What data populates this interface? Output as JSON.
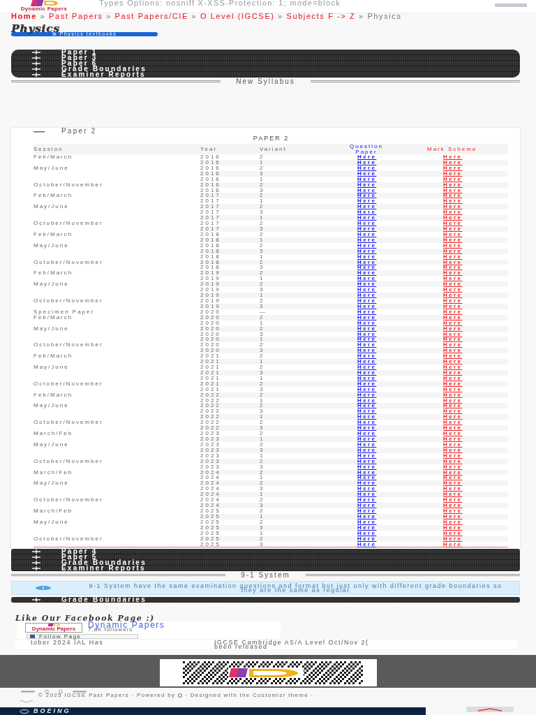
{
  "header": {
    "logo_text": "Dynamic Papers",
    "text": "Types Options: nosniff X-XSS-Protection: 1; mode=block"
  },
  "breadcrumb": {
    "separator": "»",
    "links": [
      "Home",
      "Past Papers",
      "Past Papers/CIE",
      "O Level (IGCSE)",
      "Subjects F -> Z"
    ],
    "current": "Physics"
  },
  "title": "Physics",
  "textbooks_button": "⊕ Physics textbooks",
  "sections": [
    {
      "items": [
        {
          "label": "Paper 1",
          "expanded": false
        },
        {
          "label": "Paper 3",
          "expanded": false
        },
        {
          "label": "Paper 6",
          "expanded": false
        },
        {
          "label": "Grade Boundaries",
          "expanded": false
        },
        {
          "label": "Examiner Reports",
          "expanded": false
        }
      ]
    },
    {
      "divider": "New Syllabus",
      "items": [
        {
          "label": "Paper 2",
          "expanded": true,
          "table": {
            "title": "PAPER 2",
            "columns": [
              "Session",
              "Year",
              "Variant",
              "Question Paper",
              "Mark Scheme"
            ],
            "groups": [
              {
                "session": "Feb/March",
                "rows": [
                  {
                    "year": "2016",
                    "variant": "2",
                    "question_paper": "Here",
                    "mark_scheme": "Here"
                  }
                ]
              },
              {
                "session": "May/June",
                "rows": [
                  {
                    "year": "2016",
                    "variant": "1",
                    "question_paper": "Here",
                    "mark_scheme": "Here"
                  },
                  {
                    "year": "2016",
                    "variant": "2",
                    "question_paper": "Here",
                    "mark_scheme": "Here"
                  },
                  {
                    "year": "2016",
                    "variant": "3",
                    "question_paper": "Here",
                    "mark_scheme": "Here"
                  }
                ]
              },
              {
                "session": "October/November",
                "rows": [
                  {
                    "year": "2016",
                    "variant": "1",
                    "question_paper": "Here",
                    "mark_scheme": "Here"
                  },
                  {
                    "year": "2016",
                    "variant": "2",
                    "question_paper": "Here",
                    "mark_scheme": "Here"
                  },
                  {
                    "year": "2016",
                    "variant": "3",
                    "question_paper": "Here",
                    "mark_scheme": "Here"
                  }
                ]
              },
              {
                "session": "Feb/March",
                "rows": [
                  {
                    "year": "2017",
                    "variant": "2",
                    "question_paper": "Here",
                    "mark_scheme": "Here"
                  }
                ]
              },
              {
                "session": "May/June",
                "rows": [
                  {
                    "year": "2017",
                    "variant": "1",
                    "question_paper": "Here",
                    "mark_scheme": "Here"
                  },
                  {
                    "year": "2017",
                    "variant": "2",
                    "question_paper": "Here",
                    "mark_scheme": "Here"
                  },
                  {
                    "year": "2017",
                    "variant": "3",
                    "question_paper": "Here",
                    "mark_scheme": "Here"
                  }
                ]
              },
              {
                "session": "October/November",
                "rows": [
                  {
                    "year": "2017",
                    "variant": "1",
                    "question_paper": "Here",
                    "mark_scheme": "Here"
                  },
                  {
                    "year": "2017",
                    "variant": "2",
                    "question_paper": "Here",
                    "mark_scheme": "Here"
                  },
                  {
                    "year": "2017",
                    "variant": "3",
                    "question_paper": "Here",
                    "mark_scheme": "Here"
                  }
                ]
              },
              {
                "session": "Feb/March",
                "rows": [
                  {
                    "year": "2018",
                    "variant": "2",
                    "question_paper": "Here",
                    "mark_scheme": "Here"
                  }
                ]
              },
              {
                "session": "May/June",
                "rows": [
                  {
                    "year": "2018",
                    "variant": "1",
                    "question_paper": "Here",
                    "mark_scheme": "Here"
                  },
                  {
                    "year": "2018",
                    "variant": "2",
                    "question_paper": "Here",
                    "mark_scheme": "Here"
                  },
                  {
                    "year": "2018",
                    "variant": "3",
                    "question_paper": "Here",
                    "mark_scheme": "Here"
                  }
                ]
              },
              {
                "session": "October/November",
                "rows": [
                  {
                    "year": "2018",
                    "variant": "1",
                    "question_paper": "Here",
                    "mark_scheme": "Here"
                  },
                  {
                    "year": "2018",
                    "variant": "2",
                    "question_paper": "Here",
                    "mark_scheme": "Here"
                  },
                  {
                    "year": "2018",
                    "variant": "3",
                    "question_paper": "Here",
                    "mark_scheme": "Here"
                  }
                ]
              },
              {
                "session": "Feb/March",
                "rows": [
                  {
                    "year": "2019",
                    "variant": "2",
                    "question_paper": "Here",
                    "mark_scheme": "Here"
                  }
                ]
              },
              {
                "session": "May/June",
                "rows": [
                  {
                    "year": "2019",
                    "variant": "1",
                    "question_paper": "Here",
                    "mark_scheme": "Here"
                  },
                  {
                    "year": "2019",
                    "variant": "2",
                    "question_paper": "Here",
                    "mark_scheme": "Here"
                  },
                  {
                    "year": "2019",
                    "variant": "3",
                    "question_paper": "Here",
                    "mark_scheme": "Here"
                  }
                ]
              },
              {
                "session": "October/November",
                "rows": [
                  {
                    "year": "2019",
                    "variant": "1",
                    "question_paper": "Here",
                    "mark_scheme": "Here"
                  },
                  {
                    "year": "2019",
                    "variant": "2",
                    "question_paper": "Here",
                    "mark_scheme": "Here"
                  },
                  {
                    "year": "2019",
                    "variant": "3",
                    "question_paper": "Here",
                    "mark_scheme": "Here"
                  }
                ]
              },
              {
                "session": "Specimen Paper",
                "rows": [
                  {
                    "year": "2020",
                    "variant": "—",
                    "question_paper": "Here",
                    "mark_scheme": "Here"
                  }
                ]
              },
              {
                "session": "Feb/March",
                "rows": [
                  {
                    "year": "2020",
                    "variant": "2",
                    "question_paper": "Here",
                    "mark_scheme": "Here"
                  }
                ]
              },
              {
                "session": "May/June",
                "rows": [
                  {
                    "year": "2020",
                    "variant": "1",
                    "question_paper": "Here",
                    "mark_scheme": "Here"
                  },
                  {
                    "year": "2020",
                    "variant": "2",
                    "question_paper": "Here",
                    "mark_scheme": "Here"
                  },
                  {
                    "year": "2020",
                    "variant": "3",
                    "question_paper": "Here",
                    "mark_scheme": "Here"
                  }
                ]
              },
              {
                "session": "October/November",
                "rows": [
                  {
                    "year": "2020",
                    "variant": "1",
                    "question_paper": "Here",
                    "mark_scheme": "Here"
                  },
                  {
                    "year": "2020",
                    "variant": "2",
                    "question_paper": "Here",
                    "mark_scheme": "Here"
                  },
                  {
                    "year": "2020",
                    "variant": "3",
                    "question_paper": "Here",
                    "mark_scheme": "Here"
                  }
                ]
              },
              {
                "session": "Feb/March",
                "rows": [
                  {
                    "year": "2021",
                    "variant": "2",
                    "question_paper": "Here",
                    "mark_scheme": "Here"
                  }
                ]
              },
              {
                "session": "May/June",
                "rows": [
                  {
                    "year": "2021",
                    "variant": "1",
                    "question_paper": "Here",
                    "mark_scheme": "Here"
                  },
                  {
                    "year": "2021",
                    "variant": "2",
                    "question_paper": "Here",
                    "mark_scheme": "Here"
                  },
                  {
                    "year": "2021",
                    "variant": "3",
                    "question_paper": "Here",
                    "mark_scheme": "Here"
                  }
                ]
              },
              {
                "session": "October/November",
                "rows": [
                  {
                    "year": "2021",
                    "variant": "1",
                    "question_paper": "Here",
                    "mark_scheme": "Here"
                  },
                  {
                    "year": "2021",
                    "variant": "2",
                    "question_paper": "Here",
                    "mark_scheme": "Here"
                  },
                  {
                    "year": "2021",
                    "variant": "3",
                    "question_paper": "Here",
                    "mark_scheme": "Here"
                  }
                ]
              },
              {
                "session": "Feb/March",
                "rows": [
                  {
                    "year": "2022",
                    "variant": "2",
                    "question_paper": "Here",
                    "mark_scheme": "Here"
                  }
                ]
              },
              {
                "session": "May/June",
                "rows": [
                  {
                    "year": "2022",
                    "variant": "1",
                    "question_paper": "Here",
                    "mark_scheme": "Here"
                  },
                  {
                    "year": "2022",
                    "variant": "2",
                    "question_paper": "Here",
                    "mark_scheme": "Here"
                  },
                  {
                    "year": "2022",
                    "variant": "3",
                    "question_paper": "Here",
                    "mark_scheme": "Here"
                  }
                ]
              },
              {
                "session": "October/November",
                "rows": [
                  {
                    "year": "2022",
                    "variant": "1",
                    "question_paper": "Here",
                    "mark_scheme": "Here"
                  },
                  {
                    "year": "2022",
                    "variant": "2",
                    "question_paper": "Here",
                    "mark_scheme": "Here"
                  },
                  {
                    "year": "2022",
                    "variant": "3",
                    "question_paper": "Here",
                    "mark_scheme": "Here"
                  }
                ]
              },
              {
                "session": "March/Feb",
                "rows": [
                  {
                    "year": "2023",
                    "variant": "2",
                    "question_paper": "Here",
                    "mark_scheme": "Here"
                  }
                ]
              },
              {
                "session": "May/June",
                "rows": [
                  {
                    "year": "2023",
                    "variant": "1",
                    "question_paper": "Here",
                    "mark_scheme": "Here"
                  },
                  {
                    "year": "2023",
                    "variant": "2",
                    "question_paper": "Here",
                    "mark_scheme": "Here"
                  },
                  {
                    "year": "2023",
                    "variant": "3",
                    "question_paper": "Here",
                    "mark_scheme": "Here"
                  }
                ]
              },
              {
                "session": "October/November",
                "rows": [
                  {
                    "year": "2023",
                    "variant": "1",
                    "question_paper": "Here",
                    "mark_scheme": "Here"
                  },
                  {
                    "year": "2023",
                    "variant": "2",
                    "question_paper": "Here",
                    "mark_scheme": "Here"
                  },
                  {
                    "year": "2023",
                    "variant": "3",
                    "question_paper": "Here",
                    "mark_scheme": "Here"
                  }
                ]
              },
              {
                "session": "March/Feb",
                "rows": [
                  {
                    "year": "2024",
                    "variant": "2",
                    "question_paper": "Here",
                    "mark_scheme": "Here"
                  }
                ]
              },
              {
                "session": "May/June",
                "rows": [
                  {
                    "year": "2024",
                    "variant": "1",
                    "question_paper": "Here",
                    "mark_scheme": "Here"
                  },
                  {
                    "year": "2024",
                    "variant": "2",
                    "question_paper": "Here",
                    "mark_scheme": "Here"
                  },
                  {
                    "year": "2024",
                    "variant": "3",
                    "question_paper": "Here",
                    "mark_scheme": "Here"
                  }
                ]
              },
              {
                "session": "October/November",
                "rows": [
                  {
                    "year": "2024",
                    "variant": "1",
                    "question_paper": "Here",
                    "mark_scheme": "Here"
                  },
                  {
                    "year": "2024",
                    "variant": "2",
                    "question_paper": "Here",
                    "mark_scheme": "Here"
                  },
                  {
                    "year": "2024",
                    "variant": "3",
                    "question_paper": "Here",
                    "mark_scheme": "Here"
                  }
                ]
              },
              {
                "session": "March/Feb",
                "rows": [
                  {
                    "year": "2025",
                    "variant": "2",
                    "question_paper": "Here",
                    "mark_scheme": "Here"
                  }
                ]
              },
              {
                "session": "May/June",
                "rows": [
                  {
                    "year": "2025",
                    "variant": "1",
                    "question_paper": "Here",
                    "mark_scheme": "Here"
                  },
                  {
                    "year": "2025",
                    "variant": "2",
                    "question_paper": "Here",
                    "mark_scheme": "Here"
                  },
                  {
                    "year": "2025",
                    "variant": "3",
                    "question_paper": "Here",
                    "mark_scheme": "Here"
                  }
                ]
              },
              {
                "session": "October/November",
                "rows": [
                  {
                    "year": "2025",
                    "variant": "1",
                    "question_paper": "Here",
                    "mark_scheme": "Here"
                  },
                  {
                    "year": "2025",
                    "variant": "2",
                    "question_paper": "Here",
                    "mark_scheme": "Here"
                  },
                  {
                    "year": "2025",
                    "variant": "3",
                    "question_paper": "Here",
                    "mark_scheme": "Here"
                  }
                ]
              }
            ]
          }
        },
        {
          "label": "Paper 4",
          "expanded": false
        },
        {
          "label": "Paper 5",
          "expanded": false
        },
        {
          "label": "Grade Boundaries",
          "expanded": false
        },
        {
          "label": "Examiner Reports",
          "expanded": false
        }
      ]
    },
    {
      "divider": "9-1 System",
      "notice": "9-1 System have the same examination questions and format but just only with different grade boundaries so they are the same as regular",
      "items": [
        {
          "label": "Grade Boundaries",
          "expanded": false
        }
      ]
    }
  ],
  "facebook": {
    "heading": "Like Our Facebook Page :)",
    "logo_text": "Dynamic Papers",
    "page_name": "Dynamic Papers",
    "followers": "7.8K followers",
    "follow_button": "Follow Page"
  },
  "ticker": [
    {
      "lines": [
        "tober 2024 IAL Has"
      ]
    },
    {
      "lines": [
        "IGCSE Cambridge AS/A Level Oct/Nov 2(",
        "been released"
      ]
    }
  ],
  "footer": {
    "copyright": "© 2025 IGCSE Past Papers · Powered by",
    "credit": "· Designed with the Customizr theme ·"
  },
  "ad": {
    "brand": "BOEING"
  }
}
